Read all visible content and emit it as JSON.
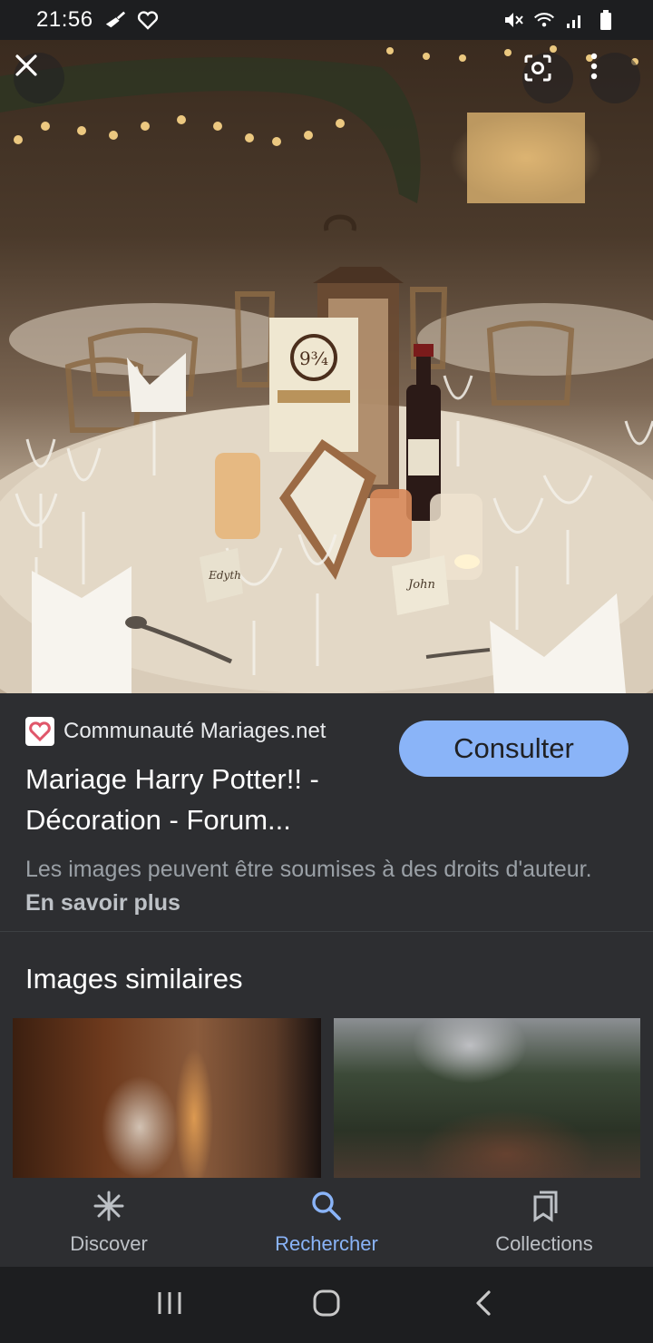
{
  "status_bar": {
    "time": "21:56",
    "icons": [
      "broom-icon",
      "heart-outline-icon",
      "mute-icon",
      "wifi-icon",
      "signal-icon",
      "battery-icon"
    ]
  },
  "hero": {
    "close_icon": "close-icon",
    "lens_icon": "lens-icon",
    "more_icon": "more-vert-icon"
  },
  "result": {
    "source_name": "Communauté Mariages.net",
    "consult_label": "Consulter",
    "title": "Mariage Harry Potter!! - Décoration - Forum...",
    "disclaimer": "Les images peuvent être soumises à des droits d'auteur.",
    "learn_more": "En savoir plus"
  },
  "similar": {
    "title": "Images similaires"
  },
  "bottom_nav": {
    "items": [
      {
        "label": "Discover",
        "icon": "asterisk-icon"
      },
      {
        "label": "Rechercher",
        "icon": "search-icon"
      },
      {
        "label": "Collections",
        "icon": "collections-icon"
      }
    ],
    "active": "Rechercher"
  },
  "colors": {
    "accent": "#8ab4f8",
    "background": "#2d2e31",
    "statusbar": "#1d1e20"
  }
}
